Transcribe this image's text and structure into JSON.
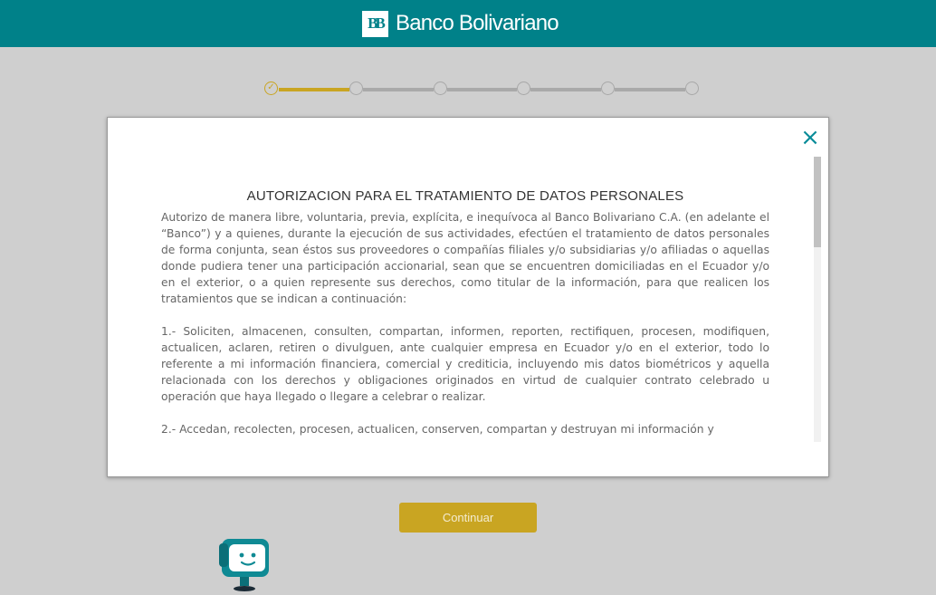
{
  "header": {
    "brand_name": "Banco Bolivariano",
    "brand_logo_letters": "BB",
    "logo_icon": "bb-logo-icon",
    "color": "#008189"
  },
  "stepper": {
    "steps_total": 6,
    "current_step": 1,
    "completed_icon": "check-icon",
    "completed_color": "#c9a522",
    "pending_color": "#a9a9a9"
  },
  "modal": {
    "close_icon": "close-icon",
    "close_symbol": "×",
    "title": "AUTORIZACION PARA EL TRATAMIENTO DE DATOS PERSONALES",
    "paragraphs": [
      "Autorizo de manera libre, voluntaria, previa, explícita, e inequívoca al Banco Bolivariano C.A. (en adelante el “Banco”) y a quienes, durante la ejecución de sus actividades, efectúen el tratamiento de datos personales de forma conjunta, sean éstos sus proveedores o compañías filiales y/o subsidiarias y/o afiliadas o aquellas donde pudiera tener una participación accionarial, sean que se encuentren domiciliadas en el Ecuador y/o en el exterior, o a quien represente sus derechos, como titular de la información, para que realicen los tratamientos que se indican a continuación:",
      "1.- Soliciten, almacenen, consulten, compartan, informen, reporten, rectifiquen, procesen, modifiquen, actualicen, aclaren, retiren o divulguen, ante cualquier empresa en Ecuador y/o en el exterior, todo lo referente a mi información financiera, comercial y crediticia, incluyendo mis datos biométricos y aquella relacionada con los derechos y obligaciones originados en virtud de cualquier contrato celebrado u operación que haya llegado o llegare a celebrar o realizar.",
      "2.- Accedan, recolecten, procesen, actualicen, conserven, compartan y destruyan mi información y"
    ]
  },
  "actions": {
    "continue_label": "Continuar",
    "button_color": "#c9a522"
  },
  "mascot": {
    "icon": "robot-mascot-icon",
    "color": "#0f8a94"
  }
}
